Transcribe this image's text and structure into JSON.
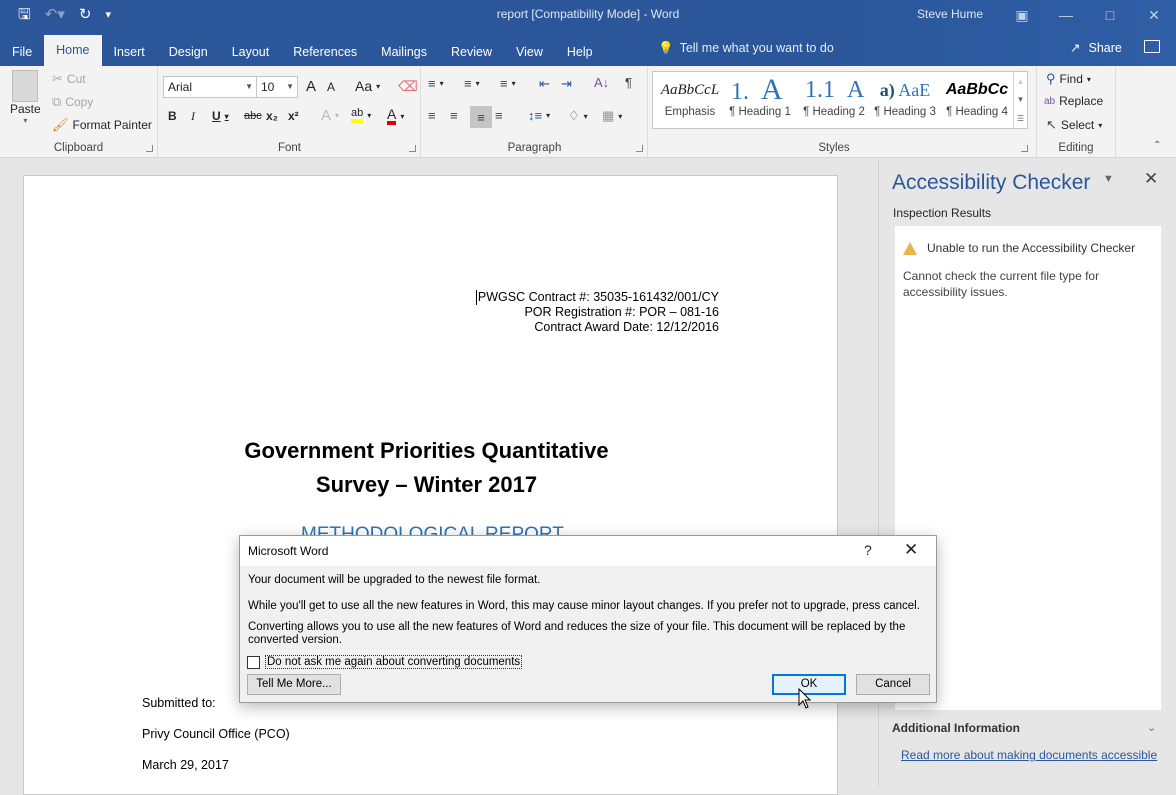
{
  "window": {
    "title": "report [Compatibility Mode]  -  Word",
    "user": "Steve Hume",
    "controls": [
      "restore-ribbon",
      "minimize",
      "maximize",
      "close"
    ]
  },
  "qat": {
    "save": "save-icon",
    "undo": "undo-icon",
    "redo": "redo-icon",
    "customize": "customize-icon"
  },
  "tabs": [
    {
      "label": "File"
    },
    {
      "label": "Home"
    },
    {
      "label": "Insert"
    },
    {
      "label": "Design"
    },
    {
      "label": "Layout"
    },
    {
      "label": "References"
    },
    {
      "label": "Mailings"
    },
    {
      "label": "Review"
    },
    {
      "label": "View"
    },
    {
      "label": "Help"
    }
  ],
  "active_tab": "Home",
  "tellme": {
    "placeholder": "Tell me what you want to do"
  },
  "share_label": "Share",
  "ribbon": {
    "clipboard": {
      "label": "Clipboard",
      "paste": "Paste",
      "cut": "Cut",
      "copy": "Copy",
      "format_painter": "Format Painter"
    },
    "font": {
      "label": "Font",
      "family": "Arial",
      "size": "10",
      "grow": "A",
      "shrink": "A",
      "case": "Aa",
      "bold": "B",
      "italic": "I",
      "underline": "U",
      "strike": "abc",
      "sub": "x₂",
      "sup": "x²",
      "highlight_color": "#ffff00",
      "font_color": "#e00000"
    },
    "paragraph": {
      "label": "Paragraph",
      "active_align": "right"
    },
    "styles": {
      "label": "Styles",
      "items": [
        {
          "preview": "AaBbCcL",
          "name": "Emphasis"
        },
        {
          "preview": "1.",
          "name": "¶ Heading 1"
        },
        {
          "preview": "A",
          "name": ""
        },
        {
          "preview": "1.1",
          "name": "¶ Heading 2"
        },
        {
          "preview": "A",
          "name": ""
        },
        {
          "preview": "a)",
          "name": "¶ Heading 3"
        },
        {
          "preview": "AaE",
          "name": ""
        },
        {
          "preview": "AaBbCc",
          "name": "¶ Heading 4"
        }
      ]
    },
    "editing": {
      "label": "Editing",
      "find": "Find",
      "replace": "Replace",
      "select": "Select"
    }
  },
  "document": {
    "header_lines": [
      "PWGSC Contract #: 35035-161432/001/CY",
      "POR Registration #: POR – 081-16",
      "Contract Award Date: 12/12/2016"
    ],
    "title_line1": "Government Priorities Quantitative",
    "title_line2": "Survey – Winter 2017",
    "subtitle": "METHODOLOGICAL REPORT",
    "submitted_to": "Submitted to:",
    "organization": "Privy Council Office (PCO)",
    "date": "March 29, 2017"
  },
  "pane": {
    "title": "Accessibility Checker",
    "inspection": "Inspection Results",
    "warning_title": "Unable to run the Accessibility Checker",
    "warning_detail": "Cannot check the current file type for accessibility issues.",
    "additional": "Additional Information",
    "link": "Read more about making documents accessible"
  },
  "dialog": {
    "title": "Microsoft Word",
    "help": "?",
    "line1": "Your document will be upgraded to the newest file format.",
    "line2": "While you'll get to use all the new features in Word, this may cause minor layout changes. If you prefer not to upgrade, press cancel.",
    "line3": "Converting allows you to use all the new features of Word and reduces the size of your file. This document will be replaced by the converted version.",
    "checkbox_label": "Do not ask me again about converting documents",
    "checkbox_checked": false,
    "tell_more": "Tell Me More...",
    "ok": "OK",
    "cancel": "Cancel"
  }
}
